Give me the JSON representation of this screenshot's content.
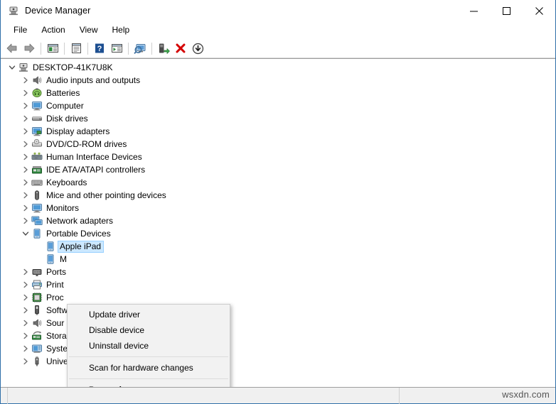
{
  "window": {
    "title": "Device Manager",
    "title_icon": "device-manager-icon",
    "controls": {
      "minimize": "─",
      "maximize": "☐",
      "close": "✕"
    }
  },
  "menubar": {
    "items": [
      {
        "label": "File",
        "name": "menu-file"
      },
      {
        "label": "Action",
        "name": "menu-action"
      },
      {
        "label": "View",
        "name": "menu-view"
      },
      {
        "label": "Help",
        "name": "menu-help"
      }
    ]
  },
  "toolbar": {
    "buttons": [
      {
        "name": "back-icon",
        "title": "Back"
      },
      {
        "name": "forward-icon",
        "title": "Forward"
      },
      {
        "name": "separator-1",
        "title": ""
      },
      {
        "name": "show-hide-console-tree-icon",
        "title": "Show/Hide Console Tree"
      },
      {
        "name": "separator-2",
        "title": ""
      },
      {
        "name": "properties-icon",
        "title": "Properties"
      },
      {
        "name": "separator-3",
        "title": ""
      },
      {
        "name": "help-icon",
        "title": "Help"
      },
      {
        "name": "show-hide-action-pane-icon",
        "title": "Show/Hide Action Pane"
      },
      {
        "name": "separator-4",
        "title": ""
      },
      {
        "name": "scan-for-hardware-changes-icon",
        "title": "Scan for hardware changes"
      },
      {
        "name": "separator-5",
        "title": ""
      },
      {
        "name": "update-driver-icon",
        "title": "Update driver"
      },
      {
        "name": "uninstall-device-icon",
        "title": "Uninstall device"
      },
      {
        "name": "disable-device-icon",
        "title": "Disable device"
      }
    ]
  },
  "tree": {
    "root": {
      "label": "DESKTOP-41K7U8K",
      "icon": "computer-root-icon",
      "expanded": true,
      "indent": 0
    },
    "items": [
      {
        "label": "Audio inputs and outputs",
        "icon": "speaker-icon",
        "expanded": false,
        "indent": 1,
        "selected": false
      },
      {
        "label": "Batteries",
        "icon": "battery-icon",
        "expanded": false,
        "indent": 1,
        "selected": false
      },
      {
        "label": "Computer",
        "icon": "monitor-icon",
        "expanded": false,
        "indent": 1,
        "selected": false
      },
      {
        "label": "Disk drives",
        "icon": "disk-drive-icon",
        "expanded": false,
        "indent": 1,
        "selected": false
      },
      {
        "label": "Display adapters",
        "icon": "display-adapter-icon",
        "expanded": false,
        "indent": 1,
        "selected": false
      },
      {
        "label": "DVD/CD-ROM drives",
        "icon": "dvd-drive-icon",
        "expanded": false,
        "indent": 1,
        "selected": false
      },
      {
        "label": "Human Interface Devices",
        "icon": "hid-icon",
        "expanded": false,
        "indent": 1,
        "selected": false
      },
      {
        "label": "IDE ATA/ATAPI controllers",
        "icon": "ide-controller-icon",
        "expanded": false,
        "indent": 1,
        "selected": false
      },
      {
        "label": "Keyboards",
        "icon": "keyboard-icon",
        "expanded": false,
        "indent": 1,
        "selected": false
      },
      {
        "label": "Mice and other pointing devices",
        "icon": "mouse-icon",
        "expanded": false,
        "indent": 1,
        "selected": false
      },
      {
        "label": "Monitors",
        "icon": "monitor-icon",
        "expanded": false,
        "indent": 1,
        "selected": false
      },
      {
        "label": "Network adapters",
        "icon": "network-adapter-icon",
        "expanded": false,
        "indent": 1,
        "selected": false
      },
      {
        "label": "Portable Devices",
        "icon": "portable-device-icon",
        "expanded": true,
        "indent": 1,
        "selected": false
      },
      {
        "label": "Apple iPad",
        "icon": "portable-device-icon",
        "expanded": null,
        "indent": 2,
        "selected": true
      },
      {
        "label": "M",
        "icon": "portable-device-icon",
        "expanded": null,
        "indent": 2,
        "selected": false
      },
      {
        "label": "Ports",
        "icon": "port-icon",
        "expanded": false,
        "indent": 1,
        "selected": false
      },
      {
        "label": "Print",
        "icon": "printer-icon",
        "expanded": false,
        "indent": 1,
        "selected": false
      },
      {
        "label": "Proc",
        "icon": "processor-icon",
        "expanded": false,
        "indent": 1,
        "selected": false
      },
      {
        "label": "Softw",
        "icon": "software-device-icon",
        "expanded": false,
        "indent": 1,
        "selected": false
      },
      {
        "label": "Sour",
        "icon": "speaker-icon",
        "expanded": false,
        "indent": 1,
        "selected": false
      },
      {
        "label": "Stora",
        "icon": "storage-controller-icon",
        "expanded": false,
        "indent": 1,
        "selected": false
      },
      {
        "label": "System devices",
        "icon": "system-device-icon",
        "expanded": false,
        "indent": 1,
        "selected": false
      },
      {
        "label": "Universal Serial Bus controllers",
        "icon": "usb-icon",
        "expanded": false,
        "indent": 1,
        "selected": false
      }
    ]
  },
  "context_menu": {
    "visible": true,
    "items": [
      {
        "label": "Update driver",
        "type": "item",
        "bold": false,
        "name": "ctx-update-driver"
      },
      {
        "label": "Disable device",
        "type": "item",
        "bold": false,
        "name": "ctx-disable-device"
      },
      {
        "label": "Uninstall device",
        "type": "item",
        "bold": false,
        "name": "ctx-uninstall-device"
      },
      {
        "label": "",
        "type": "separator",
        "bold": false,
        "name": "ctx-separator-1"
      },
      {
        "label": "Scan for hardware changes",
        "type": "item",
        "bold": false,
        "name": "ctx-scan-hardware-changes"
      },
      {
        "label": "",
        "type": "separator",
        "bold": false,
        "name": "ctx-separator-2"
      },
      {
        "label": "Properties",
        "type": "item",
        "bold": true,
        "name": "ctx-properties"
      }
    ]
  },
  "statusbar": {
    "pane_text": "",
    "watermark": "wsxdn.com"
  },
  "colors": {
    "window_border": "#2f6fa8",
    "selection_fill": "#cce8ff",
    "selection_border": "#99d1ff",
    "menu_bg": "#f2f2f2",
    "statusbar_bg": "#f0f0f0",
    "accent_red": "#d40000",
    "accent_green": "#39a845",
    "accent_blue": "#2b6fb8"
  }
}
